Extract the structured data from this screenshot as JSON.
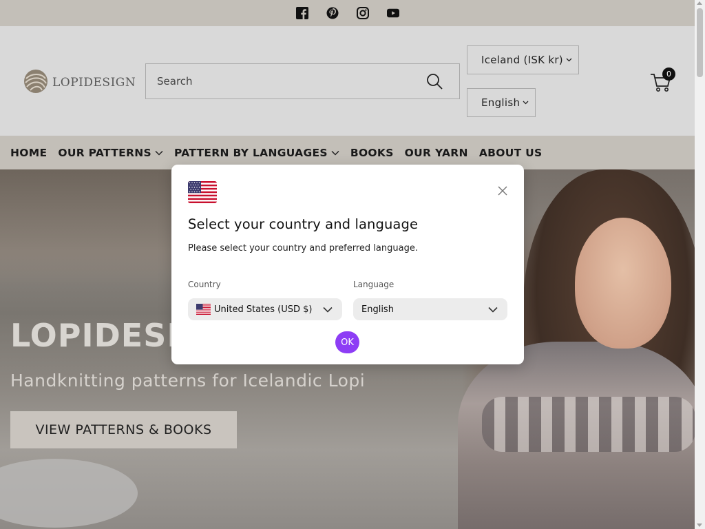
{
  "social": {
    "icons": [
      "facebook-icon",
      "pinterest-icon",
      "instagram-icon",
      "youtube-icon"
    ]
  },
  "header": {
    "logo_text": "LOPIDESIGN",
    "search_placeholder": "Search",
    "country_selector": "Iceland (ISK kr)",
    "language_selector": "English",
    "cart_count": "0"
  },
  "nav": {
    "items": [
      {
        "label": "HOME"
      },
      {
        "label": "OUR PATTERNS"
      },
      {
        "label": "PATTERN BY LANGUAGES"
      },
      {
        "label": "BOOKS"
      },
      {
        "label": "OUR YARN"
      },
      {
        "label": "ABOUT US"
      }
    ]
  },
  "hero": {
    "title": "LOPIDESIG",
    "subtitle": "Handknitting patterns for Icelandic Lopi",
    "cta": "VIEW PATTERNS & BOOKS"
  },
  "modal": {
    "title": "Select your country and language",
    "description": "Please select your country and preferred language.",
    "country_label": "Country",
    "country_value": "United States (USD $)",
    "language_label": "Language",
    "language_value": "English",
    "ok_label": "OK",
    "accent_color": "#8d3df5"
  }
}
